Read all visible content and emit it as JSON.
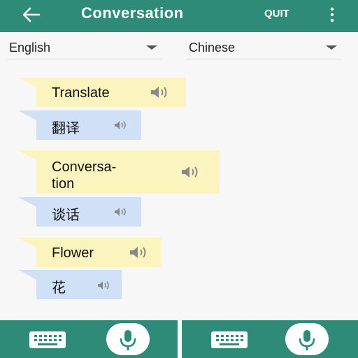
{
  "header": {
    "title": "Conversation",
    "quit_label": "QUIT",
    "back_icon": "arrow-left-icon",
    "menu_icon": "more-vertical-icon"
  },
  "languages": {
    "source": "English",
    "target": "Chinese"
  },
  "conversation": [
    {
      "english": "Translate",
      "chinese": "翻译"
    },
    {
      "english": "Conversa-\ntion",
      "chinese": "谈话"
    },
    {
      "english": "Flower",
      "chinese": "花"
    }
  ],
  "bottom_bar": {
    "keyboard_icon": "keyboard-icon",
    "mic_icon": "microphone-icon"
  },
  "colors": {
    "primary": "#2e8b78",
    "english_bubble": "#fcf4bf",
    "chinese_bubble": "#cfe0f7"
  }
}
